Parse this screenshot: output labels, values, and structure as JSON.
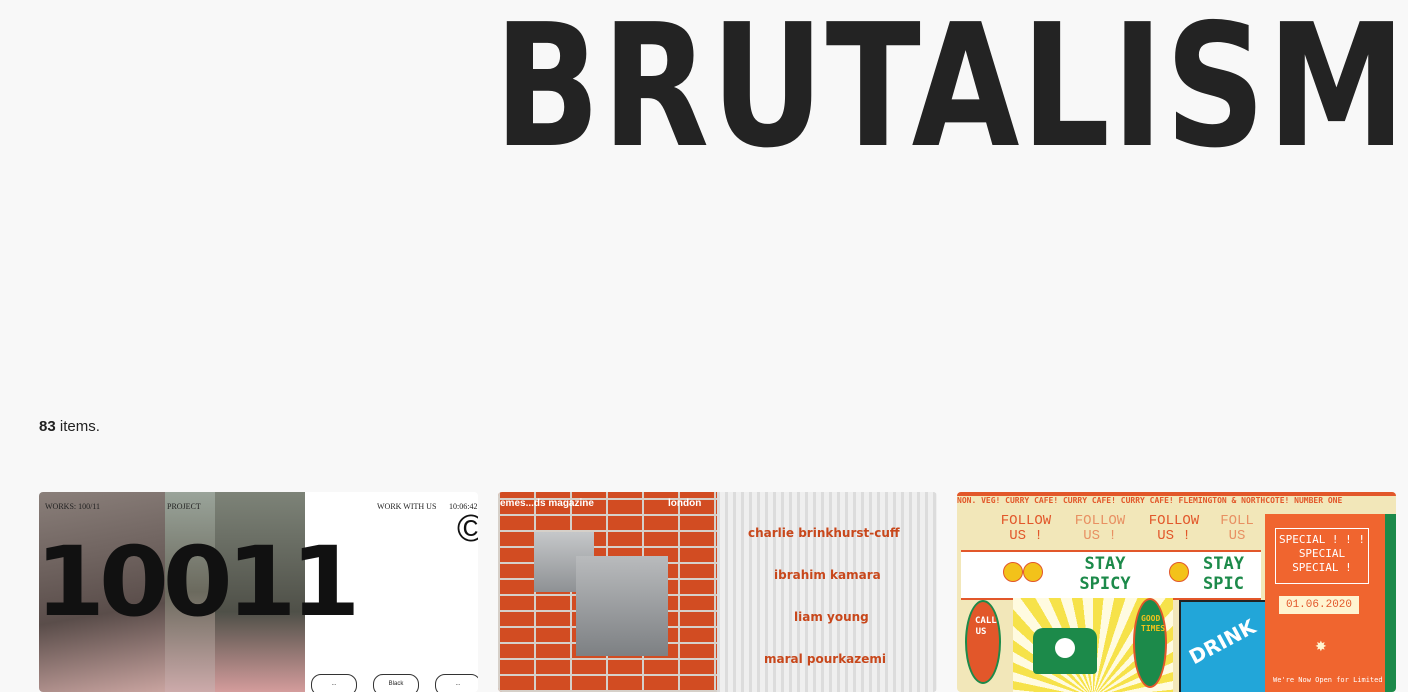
{
  "page": {
    "title": "BRUTALISM",
    "count_number": "83",
    "count_suffix": " items."
  },
  "cards": [
    {
      "nav": [
        "WORKS: 100/11",
        "PROJECT",
        "WORK WITH US",
        "10:06:42"
      ],
      "headline": "10011",
      "copyright_glyph": "©",
      "pills": [
        "...",
        "Black",
        "..."
      ]
    },
    {
      "magazine": "emes...ds magazine",
      "city": "london",
      "names": [
        "charlie brinkhurst-cuff",
        "ibrahim kamara",
        "liam young",
        "maral pourkazemi"
      ]
    },
    {
      "ticker": "NON. VEG! CURRY CAFE!    CURRY CAFE! CURRY CAFE! FLEMINGTON & NORTHCOTE! NUMBER ONE",
      "follow": [
        "FOLLOW US !",
        "FOLLOW US !",
        "FOLLOW US !",
        "FOLL US"
      ],
      "stay": [
        "STAY SPICY",
        "STAY SPIC"
      ],
      "call_us": "CALL US",
      "good_times": "GOOD TIMES",
      "drink": "DRINK",
      "special": "SPECIAL ! ! ! SPECIAL SPECIAL !",
      "date": "01.06.2020",
      "open_text": "We're Now Open for Limited"
    }
  ],
  "colors": {
    "background": "#f8f8f8",
    "brick": "#d24c22",
    "cafe_orange": "#e2572a",
    "cafe_green": "#1c8a4a",
    "cafe_blue": "#22a6d9"
  }
}
